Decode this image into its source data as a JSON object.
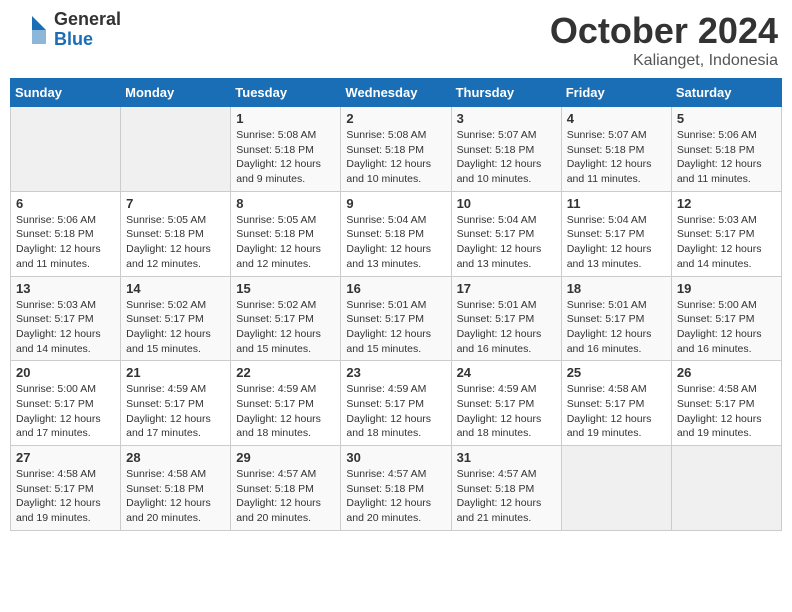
{
  "logo": {
    "general": "General",
    "blue": "Blue"
  },
  "header": {
    "title": "October 2024",
    "subtitle": "Kalianget, Indonesia"
  },
  "weekdays": [
    "Sunday",
    "Monday",
    "Tuesday",
    "Wednesday",
    "Thursday",
    "Friday",
    "Saturday"
  ],
  "weeks": [
    [
      null,
      null,
      {
        "day": 1,
        "sunrise": "5:08 AM",
        "sunset": "5:18 PM",
        "daylight": "12 hours and 9 minutes."
      },
      {
        "day": 2,
        "sunrise": "5:08 AM",
        "sunset": "5:18 PM",
        "daylight": "12 hours and 10 minutes."
      },
      {
        "day": 3,
        "sunrise": "5:07 AM",
        "sunset": "5:18 PM",
        "daylight": "12 hours and 10 minutes."
      },
      {
        "day": 4,
        "sunrise": "5:07 AM",
        "sunset": "5:18 PM",
        "daylight": "12 hours and 11 minutes."
      },
      {
        "day": 5,
        "sunrise": "5:06 AM",
        "sunset": "5:18 PM",
        "daylight": "12 hours and 11 minutes."
      }
    ],
    [
      {
        "day": 6,
        "sunrise": "5:06 AM",
        "sunset": "5:18 PM",
        "daylight": "12 hours and 11 minutes."
      },
      {
        "day": 7,
        "sunrise": "5:05 AM",
        "sunset": "5:18 PM",
        "daylight": "12 hours and 12 minutes."
      },
      {
        "day": 8,
        "sunrise": "5:05 AM",
        "sunset": "5:18 PM",
        "daylight": "12 hours and 12 minutes."
      },
      {
        "day": 9,
        "sunrise": "5:04 AM",
        "sunset": "5:18 PM",
        "daylight": "12 hours and 13 minutes."
      },
      {
        "day": 10,
        "sunrise": "5:04 AM",
        "sunset": "5:17 PM",
        "daylight": "12 hours and 13 minutes."
      },
      {
        "day": 11,
        "sunrise": "5:04 AM",
        "sunset": "5:17 PM",
        "daylight": "12 hours and 13 minutes."
      },
      {
        "day": 12,
        "sunrise": "5:03 AM",
        "sunset": "5:17 PM",
        "daylight": "12 hours and 14 minutes."
      }
    ],
    [
      {
        "day": 13,
        "sunrise": "5:03 AM",
        "sunset": "5:17 PM",
        "daylight": "12 hours and 14 minutes."
      },
      {
        "day": 14,
        "sunrise": "5:02 AM",
        "sunset": "5:17 PM",
        "daylight": "12 hours and 15 minutes."
      },
      {
        "day": 15,
        "sunrise": "5:02 AM",
        "sunset": "5:17 PM",
        "daylight": "12 hours and 15 minutes."
      },
      {
        "day": 16,
        "sunrise": "5:01 AM",
        "sunset": "5:17 PM",
        "daylight": "12 hours and 15 minutes."
      },
      {
        "day": 17,
        "sunrise": "5:01 AM",
        "sunset": "5:17 PM",
        "daylight": "12 hours and 16 minutes."
      },
      {
        "day": 18,
        "sunrise": "5:01 AM",
        "sunset": "5:17 PM",
        "daylight": "12 hours and 16 minutes."
      },
      {
        "day": 19,
        "sunrise": "5:00 AM",
        "sunset": "5:17 PM",
        "daylight": "12 hours and 16 minutes."
      }
    ],
    [
      {
        "day": 20,
        "sunrise": "5:00 AM",
        "sunset": "5:17 PM",
        "daylight": "12 hours and 17 minutes."
      },
      {
        "day": 21,
        "sunrise": "4:59 AM",
        "sunset": "5:17 PM",
        "daylight": "12 hours and 17 minutes."
      },
      {
        "day": 22,
        "sunrise": "4:59 AM",
        "sunset": "5:17 PM",
        "daylight": "12 hours and 18 minutes."
      },
      {
        "day": 23,
        "sunrise": "4:59 AM",
        "sunset": "5:17 PM",
        "daylight": "12 hours and 18 minutes."
      },
      {
        "day": 24,
        "sunrise": "4:59 AM",
        "sunset": "5:17 PM",
        "daylight": "12 hours and 18 minutes."
      },
      {
        "day": 25,
        "sunrise": "4:58 AM",
        "sunset": "5:17 PM",
        "daylight": "12 hours and 19 minutes."
      },
      {
        "day": 26,
        "sunrise": "4:58 AM",
        "sunset": "5:17 PM",
        "daylight": "12 hours and 19 minutes."
      }
    ],
    [
      {
        "day": 27,
        "sunrise": "4:58 AM",
        "sunset": "5:17 PM",
        "daylight": "12 hours and 19 minutes."
      },
      {
        "day": 28,
        "sunrise": "4:58 AM",
        "sunset": "5:18 PM",
        "daylight": "12 hours and 20 minutes."
      },
      {
        "day": 29,
        "sunrise": "4:57 AM",
        "sunset": "5:18 PM",
        "daylight": "12 hours and 20 minutes."
      },
      {
        "day": 30,
        "sunrise": "4:57 AM",
        "sunset": "5:18 PM",
        "daylight": "12 hours and 20 minutes."
      },
      {
        "day": 31,
        "sunrise": "4:57 AM",
        "sunset": "5:18 PM",
        "daylight": "12 hours and 21 minutes."
      },
      null,
      null
    ]
  ]
}
